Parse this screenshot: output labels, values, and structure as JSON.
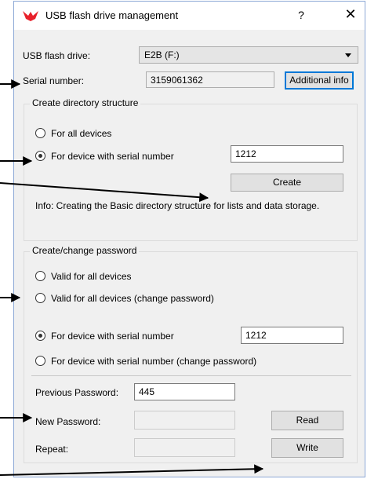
{
  "window": {
    "title": "USB flash drive management",
    "help_glyph": "?",
    "close_glyph": "✕",
    "logo_icon": "red-bird-logo-icon",
    "brand_color": "#e8212b"
  },
  "drive": {
    "label": "USB flash drive:",
    "selected": "E2B (F:)"
  },
  "serial": {
    "label": "Serial number:",
    "value": "3159061362",
    "additional_info_label": "Additional info"
  },
  "create_dir": {
    "title": "Create directory structure",
    "option_all": "For all devices",
    "option_serial": "For device with serial number",
    "selected": "serial",
    "serial_value": "1212",
    "create_label": "Create",
    "info": "Info: Creating the Basic directory structure for lists and data storage."
  },
  "password": {
    "title": "Create/change password",
    "option_all": "Valid for all devices",
    "option_all_change": "Valid for all devices (change password)",
    "option_serial": "For device with serial number",
    "option_serial_change": "For device with serial number (change password)",
    "selected": "serial",
    "serial_value": "1212",
    "previous_label": "Previous Password:",
    "previous_value": "445",
    "new_label": "New Password:",
    "new_value": "",
    "repeat_label": "Repeat:",
    "repeat_value": "",
    "read_label": "Read",
    "write_label": "Write"
  }
}
